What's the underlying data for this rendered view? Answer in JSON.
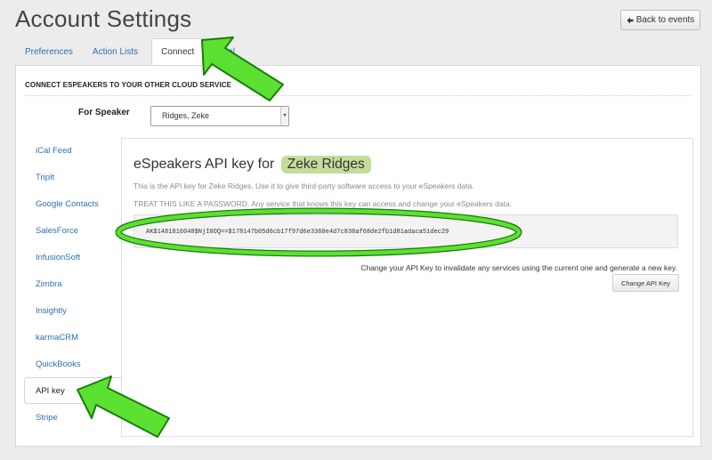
{
  "page": {
    "title": "Account Settings",
    "back_button": {
      "icon": "arrow-left-icon",
      "label": "Back to events"
    }
  },
  "tabs": [
    {
      "label": "Preferences",
      "active": false
    },
    {
      "label": "Action Lists",
      "active": false
    },
    {
      "label": "Connect",
      "active": true
    },
    {
      "label": "t Portal",
      "active": false
    }
  ],
  "section": {
    "title": "CONNECT ESPEAKERS TO YOUR OTHER CLOUD SERVICE"
  },
  "speaker_select": {
    "label": "For Speaker",
    "value": "Ridges, Zeke"
  },
  "sidebar": {
    "items": [
      {
        "label": "iCal Feed"
      },
      {
        "label": "TripIt"
      },
      {
        "label": "Google Contacts"
      },
      {
        "label": "SalesForce"
      },
      {
        "label": "InfusionSoft"
      },
      {
        "label": "Zimbra"
      },
      {
        "label": "Insightly"
      },
      {
        "label": "karmaCRM"
      },
      {
        "label": "QuickBooks"
      },
      {
        "label": "API key",
        "active": true
      },
      {
        "label": "Stripe"
      }
    ]
  },
  "api": {
    "heading_prefix": "eSpeakers API key for",
    "speaker_name": "Zeke Ridges",
    "description": "This is the API key for Zeke Ridges. Use it to give third-party software access to your eSpeakers data.",
    "warning": "TREAT THIS LIKE A PASSWORD. Any service that knows this key can access and change your eSpeakers data.",
    "key": "AK$1481816048$NjI0OQ==$178147b05d6cb17f97d6e3360e4d7c838af68de2fb1d81adaca51dec29",
    "change_note": "Change your API Key to invalidate any services using the current one and generate a new key.",
    "change_button": "Change API Key"
  },
  "annotations": {
    "arrow_color": "#5ce032",
    "ellipse_color": "#5ce032",
    "arrow_outline": "#1b7d0e"
  }
}
